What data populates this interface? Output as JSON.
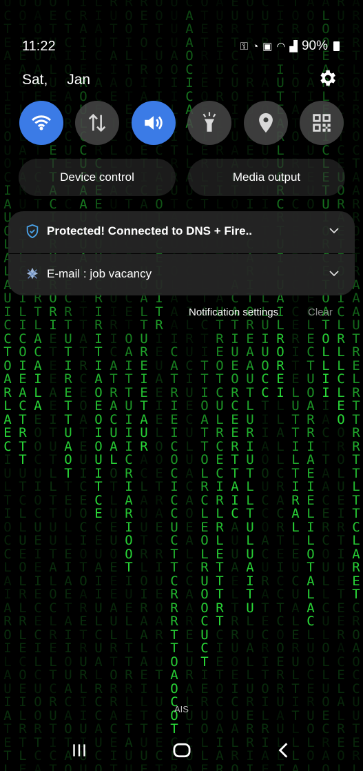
{
  "status_bar": {
    "time": "11:22",
    "battery_percent": "90%",
    "icons": [
      "key-icon",
      "data-saver-icon",
      "secure-folder-icon",
      "wifi-icon",
      "signal-icon",
      "battery-icon"
    ]
  },
  "header": {
    "date_day": "Sat,",
    "date_month": "Jan",
    "settings_icon": "gear-icon"
  },
  "quick_settings": [
    {
      "name": "wifi",
      "icon": "wifi-icon",
      "active": true
    },
    {
      "name": "mobile-data",
      "icon": "data-arrows-icon",
      "active": false
    },
    {
      "name": "sound",
      "icon": "speaker-icon",
      "active": true
    },
    {
      "name": "flashlight",
      "icon": "flashlight-icon",
      "active": false
    },
    {
      "name": "location",
      "icon": "location-pin-icon",
      "active": false
    },
    {
      "name": "qr-scanner",
      "icon": "qr-code-icon",
      "active": false
    }
  ],
  "buttons": {
    "device_control": "Device control",
    "media_output": "Media output"
  },
  "notifications": [
    {
      "text": "Protected! Connected to DNS + Fire..",
      "icon": "shield-icon"
    },
    {
      "text": "E-mail : job vacancy",
      "icon": "mail-app-icon"
    }
  ],
  "notification_actions": {
    "settings": "Notification settings",
    "clear": "Clear"
  },
  "carrier": "AIS",
  "nav": {
    "recents_icon": "recents-icon",
    "home_icon": "home-icon",
    "back_icon": "back-icon"
  },
  "colors": {
    "accent": "#3b7be6",
    "matrix_green": "#1ed32a",
    "panel": "#262626"
  }
}
